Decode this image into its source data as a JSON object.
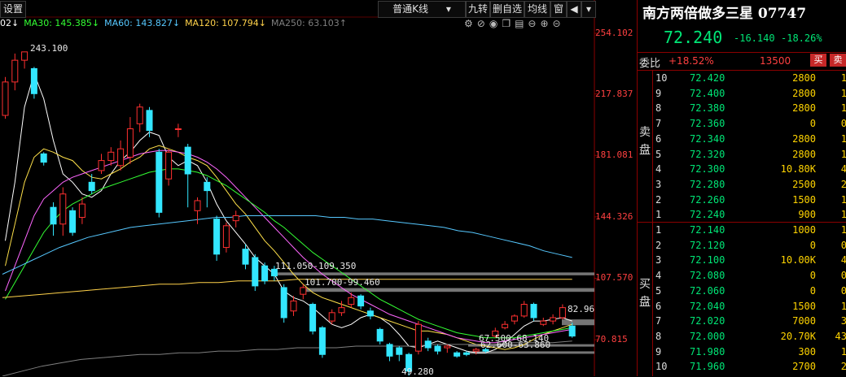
{
  "toolbar": {
    "settings_label": "设置",
    "kline_type": "普通K线",
    "jiuzhuan": "九转",
    "delete_watch": "删自选",
    "ma_line": "均线",
    "window": "窗"
  },
  "ma_legend": [
    {
      "label": "02↓",
      "color": "#ffffff"
    },
    {
      "label": "MA30: 145.385↓",
      "color": "#33ff33"
    },
    {
      "label": "MA60: 143.827↓",
      "color": "#56c8ff"
    },
    {
      "label": "MA120: 107.794↓",
      "color": "#ffd24a"
    },
    {
      "label": "MA250: 63.103↑",
      "color": "#7f7f7f"
    }
  ],
  "colors": {
    "up": "#ff3030",
    "down": "#33e6ff",
    "price_axis": "#ff4040",
    "quote_green": "#00e676",
    "volume": "#ffd400"
  },
  "chart_data": {
    "type": "candlestick",
    "ylim": [
      49.0,
      254.102
    ],
    "y_ticks": [
      254.102,
      217.837,
      181.081,
      144.326,
      107.57,
      70.815
    ],
    "y_tick_labels": [
      "254.102",
      "217.837",
      "181.081",
      "144.326",
      "107.570",
      "70.815"
    ],
    "candles": [
      {
        "o": 205,
        "c": 225,
        "h": 228,
        "l": 203
      },
      {
        "o": 225,
        "c": 238,
        "h": 242,
        "l": 220
      },
      {
        "o": 238,
        "c": 243,
        "h": 243,
        "l": 233
      },
      {
        "o": 233,
        "c": 218,
        "h": 234,
        "l": 215
      },
      {
        "o": 182,
        "c": 177,
        "h": 183,
        "l": 175
      },
      {
        "o": 150,
        "c": 140,
        "h": 153,
        "l": 133
      },
      {
        "o": 140,
        "c": 158,
        "h": 162,
        "l": 133
      },
      {
        "o": 148,
        "c": 135,
        "h": 150,
        "l": 133
      },
      {
        "o": 144,
        "c": 152,
        "h": 156,
        "l": 140
      },
      {
        "o": 165,
        "c": 160,
        "h": 170,
        "l": 158
      },
      {
        "o": 172,
        "c": 178,
        "h": 182,
        "l": 170
      },
      {
        "o": 178,
        "c": 183,
        "h": 186,
        "l": 175
      },
      {
        "o": 175,
        "c": 185,
        "h": 190,
        "l": 172
      },
      {
        "o": 180,
        "c": 197,
        "h": 204,
        "l": 176
      },
      {
        "o": 200,
        "c": 210,
        "h": 212,
        "l": 195
      },
      {
        "o": 208,
        "c": 196,
        "h": 210,
        "l": 192
      },
      {
        "o": 183,
        "c": 147,
        "h": 185,
        "l": 144
      },
      {
        "o": 167,
        "c": 183,
        "h": 185,
        "l": 163
      },
      {
        "o": 197,
        "c": 197,
        "h": 200,
        "l": 192
      },
      {
        "o": 186,
        "c": 170,
        "h": 188,
        "l": 150
      },
      {
        "o": 148,
        "c": 154,
        "h": 156,
        "l": 140
      },
      {
        "o": 165,
        "c": 160,
        "h": 168,
        "l": 150
      },
      {
        "o": 143,
        "c": 122,
        "h": 145,
        "l": 118
      },
      {
        "o": 126,
        "c": 139,
        "h": 141,
        "l": 123
      },
      {
        "o": 142,
        "c": 145,
        "h": 148,
        "l": 138
      },
      {
        "o": 125,
        "c": 116,
        "h": 128,
        "l": 113
      },
      {
        "o": 120,
        "c": 103,
        "h": 122,
        "l": 100
      },
      {
        "o": 115,
        "c": 106,
        "h": 117,
        "l": 104
      },
      {
        "o": 113,
        "c": 109,
        "h": 115,
        "l": 106
      },
      {
        "o": 102,
        "c": 84,
        "h": 104,
        "l": 81
      },
      {
        "o": 88,
        "c": 94,
        "h": 97,
        "l": 85
      },
      {
        "o": 98,
        "c": 102,
        "h": 104,
        "l": 95
      },
      {
        "o": 92,
        "c": 76,
        "h": 93,
        "l": 74
      },
      {
        "o": 78,
        "c": 62,
        "h": 79,
        "l": 60
      },
      {
        "o": 82,
        "c": 87,
        "h": 89,
        "l": 80
      },
      {
        "o": 87,
        "c": 90,
        "h": 94,
        "l": 85
      },
      {
        "o": 92,
        "c": 96,
        "h": 99,
        "l": 90
      },
      {
        "o": 97,
        "c": 91,
        "h": 98,
        "l": 89
      },
      {
        "o": 88,
        "c": 85,
        "h": 90,
        "l": 83
      },
      {
        "o": 77,
        "c": 70,
        "h": 78,
        "l": 68
      },
      {
        "o": 68,
        "c": 61,
        "h": 69,
        "l": 58
      },
      {
        "o": 66,
        "c": 62,
        "h": 67,
        "l": 58
      },
      {
        "o": 62,
        "c": 52,
        "h": 63,
        "l": 49.28
      },
      {
        "o": 64,
        "c": 80,
        "h": 82,
        "l": 62
      },
      {
        "o": 70,
        "c": 66,
        "h": 72,
        "l": 64
      },
      {
        "o": 67,
        "c": 64,
        "h": 68,
        "l": 62
      },
      {
        "o": 66,
        "c": 67,
        "h": 68,
        "l": 63
      },
      {
        "o": 63,
        "c": 61,
        "h": 64,
        "l": 60
      },
      {
        "o": 63,
        "c": 62,
        "h": 64,
        "l": 61
      },
      {
        "o": 64,
        "c": 65,
        "h": 66,
        "l": 62
      },
      {
        "o": 65,
        "c": 64,
        "h": 66,
        "l": 63
      },
      {
        "o": 73,
        "c": 76,
        "h": 78,
        "l": 72
      },
      {
        "o": 78,
        "c": 80,
        "h": 82,
        "l": 77
      },
      {
        "o": 82,
        "c": 85,
        "h": 86,
        "l": 80
      },
      {
        "o": 85,
        "c": 92,
        "h": 94,
        "l": 84
      },
      {
        "o": 92,
        "c": 84,
        "h": 93,
        "l": 82
      },
      {
        "o": 80,
        "c": 82,
        "h": 84,
        "l": 79
      },
      {
        "o": 82,
        "c": 84,
        "h": 86,
        "l": 80
      },
      {
        "o": 84,
        "c": 90,
        "h": 92,
        "l": 83
      },
      {
        "o": 79,
        "c": 73,
        "h": 81,
        "l": 72
      }
    ],
    "series": [
      {
        "id": "ma5",
        "color": "#ffffff",
        "values": [
          130,
          165,
          210,
          230,
          215,
          190,
          170,
          165,
          158,
          156,
          160,
          170,
          178,
          183,
          190,
          195,
          193,
          180,
          175,
          178,
          175,
          165,
          152,
          142,
          135,
          128,
          120,
          115,
          110,
          100,
          96,
          94,
          90,
          85,
          80,
          78,
          80,
          84,
          86,
          84,
          80,
          74,
          67,
          66,
          68,
          70,
          68,
          66,
          64,
          63,
          63,
          65,
          69,
          74,
          79,
          82,
          82,
          83,
          84,
          82
        ]
      },
      {
        "id": "ma10",
        "color": "#ffe14a",
        "values": [
          115,
          140,
          165,
          180,
          185,
          183,
          180,
          178,
          172,
          168,
          167,
          170,
          173,
          177,
          180,
          185,
          187,
          185,
          183,
          180,
          178,
          175,
          168,
          160,
          152,
          146,
          138,
          130,
          124,
          117,
          110,
          104,
          99,
          96,
          94,
          92,
          90,
          88,
          86,
          84,
          82,
          80,
          78,
          76,
          76,
          75,
          74,
          72,
          70,
          68,
          67,
          66,
          65,
          66,
          68,
          71,
          74,
          76,
          78,
          80
        ]
      },
      {
        "id": "ma20",
        "color": "#ff66ff",
        "values": [
          100,
          115,
          130,
          145,
          155,
          160,
          165,
          168,
          170,
          172,
          174,
          176,
          178,
          180,
          182,
          183,
          184,
          184,
          183,
          182,
          180,
          177,
          173,
          168,
          162,
          156,
          150,
          144,
          138,
          132,
          126,
          120,
          115,
          110,
          106,
          102,
          98,
          95,
          92,
          89,
          86,
          84,
          82,
          80,
          78,
          76,
          74,
          72,
          71,
          70,
          69,
          69,
          70,
          71,
          72,
          73,
          74,
          75,
          76,
          77
        ]
      },
      {
        "id": "ma30",
        "color": "#33ff33",
        "values": [
          95,
          105,
          115,
          125,
          135,
          142,
          148,
          152,
          155,
          158,
          161,
          163,
          165,
          167,
          169,
          171,
          172,
          173,
          173,
          172,
          171,
          169,
          166,
          163,
          159,
          155,
          151,
          147,
          142,
          138,
          133,
          128,
          123,
          119,
          115,
          111,
          107,
          103,
          99,
          95,
          92,
          89,
          86,
          83,
          81,
          79,
          77,
          75,
          74,
          73,
          72,
          72,
          72,
          72,
          73,
          74,
          75,
          76,
          77,
          78
        ]
      },
      {
        "id": "ma60",
        "color": "#56c8ff",
        "values": [
          110,
          114,
          118,
          122,
          126,
          129,
          132,
          134,
          136,
          138,
          139,
          140,
          141,
          142,
          143,
          144,
          144,
          145,
          145,
          145,
          145,
          145,
          145,
          144,
          144,
          143,
          143,
          142,
          141,
          140,
          139,
          138,
          136,
          135,
          133,
          131,
          129,
          127,
          124,
          122,
          120
        ]
      },
      {
        "id": "ma120",
        "color": "#ffd24a",
        "values": [
          96,
          97,
          98,
          99,
          100,
          101,
          102,
          103,
          104,
          104,
          105,
          105,
          106,
          106,
          106,
          107,
          107,
          107,
          107,
          107,
          107,
          107,
          107,
          107,
          107,
          107,
          107,
          107,
          107,
          107
        ]
      },
      {
        "id": "ma250",
        "color": "#7f7f7f",
        "values": [
          49,
          52,
          55,
          57,
          59,
          60,
          61,
          62,
          62,
          63,
          63,
          64,
          64,
          65,
          65,
          66,
          66,
          66,
          67,
          67,
          67,
          67,
          68,
          68,
          68,
          68,
          69,
          69,
          69,
          70
        ]
      }
    ],
    "zones": [
      {
        "label": "111.050-109.350",
        "low": 109.35,
        "high": 111.05
      },
      {
        "label": "101.700-99.460",
        "low": 99.46,
        "high": 101.7
      },
      {
        "label": "67.500-68.140",
        "low": 67.5,
        "high": 68.14
      },
      {
        "label": "62.600-63.860",
        "low": 62.6,
        "high": 63.86
      },
      {
        "label": "",
        "low": 79.5,
        "high": 82.96
      }
    ],
    "annotations": {
      "high_label": "243.100",
      "low_label": "49.280",
      "right_price": "82.96"
    }
  },
  "quote": {
    "title": "南方两倍做多三星 07747",
    "price": "72.240",
    "change": "-16.140",
    "change_pct": "-18.26%",
    "weibi_label": "委比",
    "weibi_value": "+18.52%",
    "weibi_diff": "13500",
    "buy_btn": "买",
    "sell_btn": "卖",
    "sell_side_label": "卖盘",
    "buy_side_label": "买盘",
    "asks": [
      {
        "level": "10",
        "price": "72.420",
        "vol": "2800",
        "extra": "1"
      },
      {
        "level": "9",
        "price": "72.400",
        "vol": "2800",
        "extra": "1"
      },
      {
        "level": "8",
        "price": "72.380",
        "vol": "2800",
        "extra": "1"
      },
      {
        "level": "7",
        "price": "72.360",
        "vol": "0",
        "extra": "0"
      },
      {
        "level": "6",
        "price": "72.340",
        "vol": "2800",
        "extra": "1"
      },
      {
        "level": "5",
        "price": "72.320",
        "vol": "2800",
        "extra": "1"
      },
      {
        "level": "4",
        "price": "72.300",
        "vol": "10.80K",
        "extra": "4"
      },
      {
        "level": "3",
        "price": "72.280",
        "vol": "2500",
        "extra": "2"
      },
      {
        "level": "2",
        "price": "72.260",
        "vol": "1500",
        "extra": "1"
      },
      {
        "level": "1",
        "price": "72.240",
        "vol": "900",
        "extra": "1"
      }
    ],
    "bids": [
      {
        "level": "1",
        "price": "72.140",
        "vol": "1000",
        "extra": "1"
      },
      {
        "level": "2",
        "price": "72.120",
        "vol": "0",
        "extra": "0"
      },
      {
        "level": "3",
        "price": "72.100",
        "vol": "10.00K",
        "extra": "4"
      },
      {
        "level": "4",
        "price": "72.080",
        "vol": "0",
        "extra": "0"
      },
      {
        "level": "5",
        "price": "72.060",
        "vol": "0",
        "extra": "0"
      },
      {
        "level": "6",
        "price": "72.040",
        "vol": "1500",
        "extra": "1"
      },
      {
        "level": "7",
        "price": "72.020",
        "vol": "7000",
        "extra": "3"
      },
      {
        "level": "8",
        "price": "72.000",
        "vol": "20.70K",
        "extra": "43"
      },
      {
        "level": "9",
        "price": "71.980",
        "vol": "300",
        "extra": "1"
      },
      {
        "level": "10",
        "price": "71.960",
        "vol": "2700",
        "extra": "2"
      }
    ]
  }
}
